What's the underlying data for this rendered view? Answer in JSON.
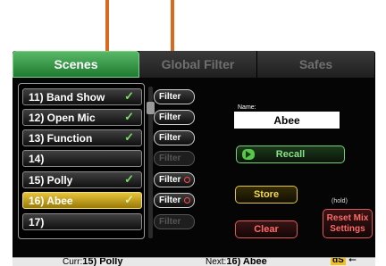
{
  "tabs": [
    {
      "label": "Scenes",
      "active": true
    },
    {
      "label": "Global Filter",
      "active": false
    },
    {
      "label": "Safes",
      "active": false
    }
  ],
  "scenes": [
    {
      "label": "11) Band Show",
      "check": "✓",
      "filter": "Filter",
      "filter_enabled": true,
      "filter_dot": false
    },
    {
      "label": "12) Open Mic",
      "check": "✓",
      "filter": "Filter",
      "filter_enabled": true,
      "filter_dot": false
    },
    {
      "label": "13) Function",
      "check": "✓",
      "filter": "Filter",
      "filter_enabled": true,
      "filter_dot": false
    },
    {
      "label": "14)",
      "check": "",
      "filter": "Filter",
      "filter_enabled": false,
      "filter_dot": false
    },
    {
      "label": "15) Polly",
      "check": "✓",
      "filter": "Filter",
      "filter_enabled": true,
      "filter_dot": true
    },
    {
      "label": "16) Abee",
      "check": "✓",
      "filter": "Filter",
      "filter_enabled": true,
      "filter_dot": true,
      "selected": true
    },
    {
      "label": "17)",
      "check": "",
      "filter": "Filter",
      "filter_enabled": false,
      "filter_dot": false
    }
  ],
  "name_field": {
    "label": "Name:",
    "value": "Abee"
  },
  "buttons": {
    "recall": "Recall",
    "store": "Store",
    "clear": "Clear",
    "hold_hint": "(hold)",
    "reset_line1": "Reset Mix",
    "reset_line2": "Settings"
  },
  "status_bar": {
    "curr_label": "Curr:",
    "curr_value": "15) Polly",
    "next_label": "Next:",
    "next_value": "16) Abee",
    "ds_badge": "dS",
    "usb_glyph": "⭠"
  },
  "colors": {
    "arrow": "#d9691c",
    "active_tab": "#3a9a4a",
    "selected_scene": "#d4ac1a",
    "recall": "#7ad07a",
    "store": "#e6c83a",
    "danger": "#e0585c"
  }
}
